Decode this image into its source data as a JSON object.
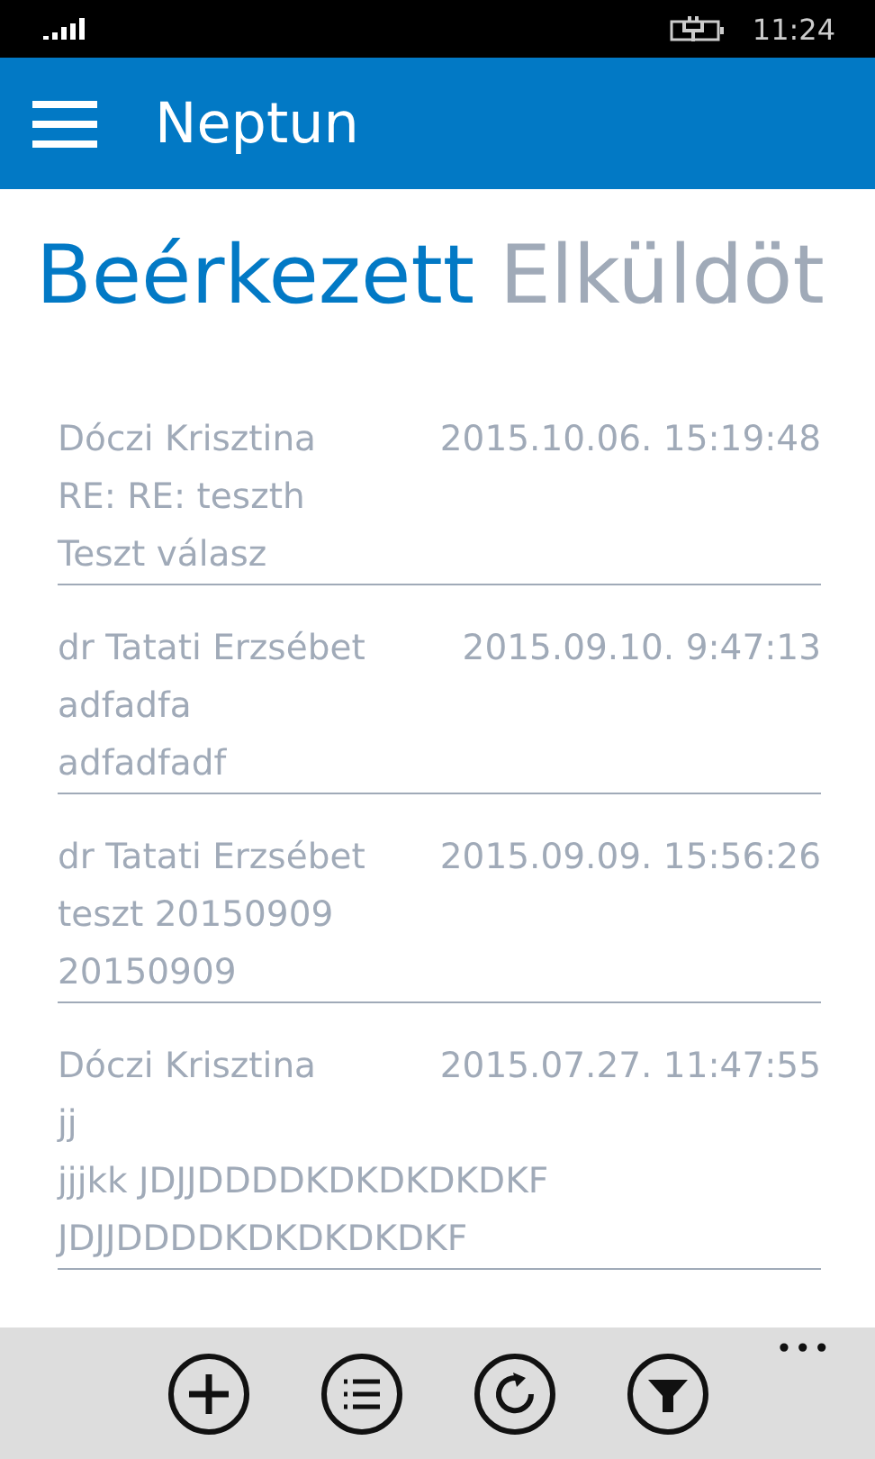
{
  "status_bar": {
    "time": "11:24"
  },
  "header": {
    "title": "Neptun"
  },
  "pivot": [
    {
      "label": "Beérkezett",
      "selected": true
    },
    {
      "label": "Elküldöt",
      "selected": false
    }
  ],
  "messages": [
    {
      "sender": "Dóczi Krisztina",
      "date": "2015.10.06. 15:19:48",
      "subject": "RE: RE: teszth",
      "body": [
        "Teszt válasz"
      ]
    },
    {
      "sender": "dr Tatati Erzsébet",
      "date": "2015.09.10. 9:47:13",
      "subject": "adfadfa",
      "body": [
        "adfadfadf"
      ]
    },
    {
      "sender": "dr Tatati Erzsébet",
      "date": "2015.09.09. 15:56:26",
      "subject": "teszt 20150909",
      "body": [
        "20150909"
      ]
    },
    {
      "sender": "Dóczi Krisztina",
      "date": "2015.07.27. 11:47:55",
      "subject": "jj",
      "body": [
        "jjjkk JDJJDDDDKDKDKDKDKF",
        "JDJJDDDDKDKDKDKDKF"
      ]
    }
  ],
  "app_bar": {
    "buttons": [
      {
        "kind": "add"
      },
      {
        "kind": "list"
      },
      {
        "kind": "refresh"
      },
      {
        "kind": "filter"
      }
    ],
    "more": "•••"
  }
}
